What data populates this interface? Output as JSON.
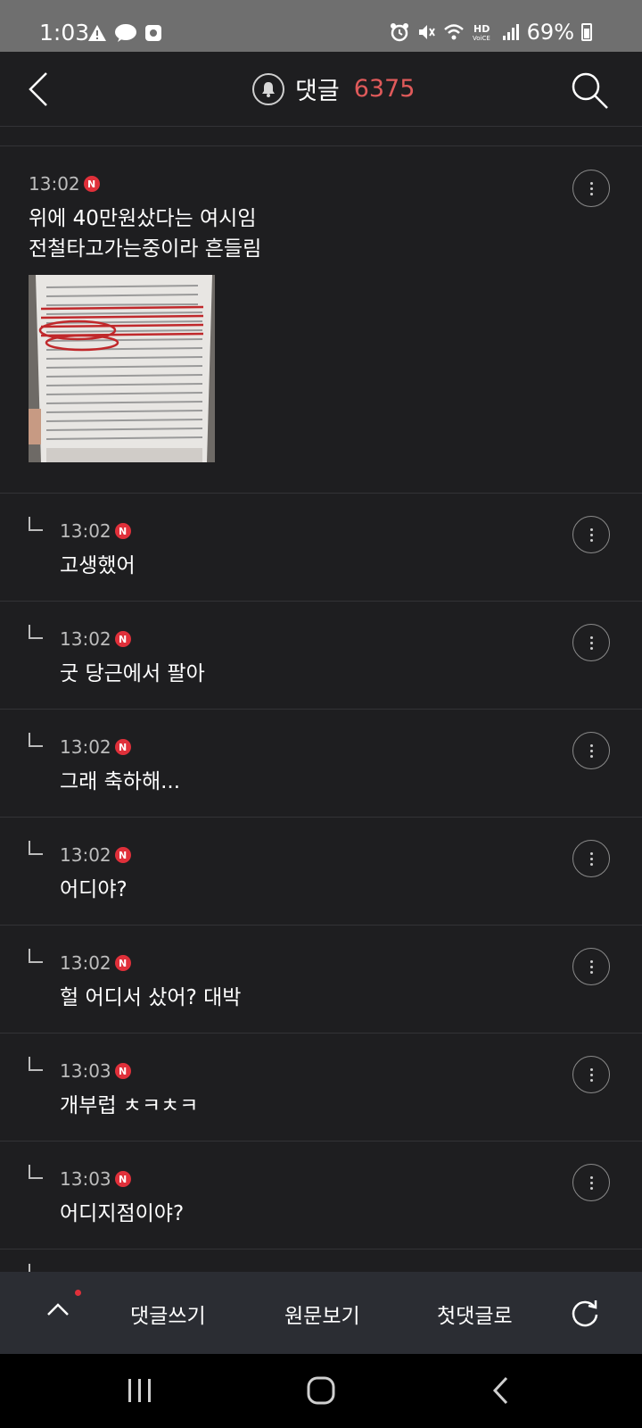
{
  "status_bar": {
    "time": "1:03",
    "battery": "69%",
    "left_icons": [
      "warning-icon",
      "talk-icon",
      "app-icon"
    ],
    "right_icons": [
      "alarm-icon",
      "mute-icon",
      "wifi-icon",
      "hd-voice-icon",
      "signal-icon",
      "battery-icon"
    ]
  },
  "header": {
    "title": "댓글",
    "count": "6375",
    "count_color": "#e05a5a"
  },
  "comments": [
    {
      "time": "13:02",
      "badge": "N",
      "text_line1": "위에 40만원샀다는 여시임",
      "text_line2": "전철타고가는중이라 흔들림",
      "has_image": true,
      "is_reply": false
    },
    {
      "time": "13:02",
      "badge": "N",
      "text": "고생했어",
      "is_reply": true
    },
    {
      "time": "13:02",
      "badge": "N",
      "text": "굿 당근에서 팔아",
      "is_reply": true
    },
    {
      "time": "13:02",
      "badge": "N",
      "text": "그래 축하해...",
      "is_reply": true
    },
    {
      "time": "13:02",
      "badge": "N",
      "text": "어디야?",
      "is_reply": true
    },
    {
      "time": "13:02",
      "badge": "N",
      "text": "헐 어디서 샀어? 대박",
      "is_reply": true
    },
    {
      "time": "13:03",
      "badge": "N",
      "text": "개부럽 ㅊㅋㅊㅋ",
      "is_reply": true
    },
    {
      "time": "13:03",
      "badge": "N",
      "text": "어디지점이야?",
      "is_reply": true
    }
  ],
  "toolbar": {
    "write": "댓글쓰기",
    "original": "원문보기",
    "first": "첫댓글로"
  },
  "colors": {
    "background": "#1e1e20",
    "toolbar": "#2b2d33",
    "badge": "#e0303a"
  }
}
